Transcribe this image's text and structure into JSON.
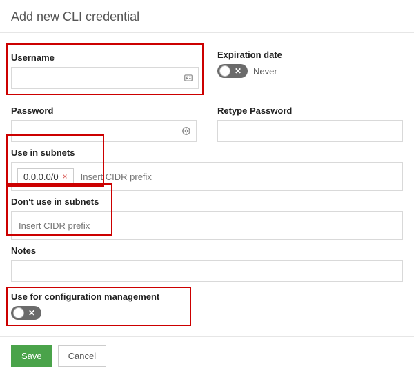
{
  "title": "Add new CLI credential",
  "username": {
    "label": "Username",
    "value": ""
  },
  "expiration": {
    "label": "Expiration date",
    "never_label": "Never",
    "enabled": false
  },
  "password": {
    "label": "Password",
    "value": ""
  },
  "retype_password": {
    "label": "Retype Password",
    "value": ""
  },
  "use_in_subnets": {
    "label": "Use in subnets",
    "chips": [
      "0.0.0.0/0"
    ],
    "placeholder": "Insert CIDR prefix"
  },
  "dont_use_in_subnets": {
    "label": "Don't use in subnets",
    "chips": [],
    "placeholder": "Insert CIDR prefix"
  },
  "notes": {
    "label": "Notes",
    "value": ""
  },
  "config_mgmt": {
    "label": "Use for configuration management",
    "enabled": false
  },
  "buttons": {
    "save": "Save",
    "cancel": "Cancel"
  },
  "highlighted_fields": [
    "username",
    "use_in_subnets",
    "dont_use_in_subnets",
    "config_mgmt"
  ]
}
